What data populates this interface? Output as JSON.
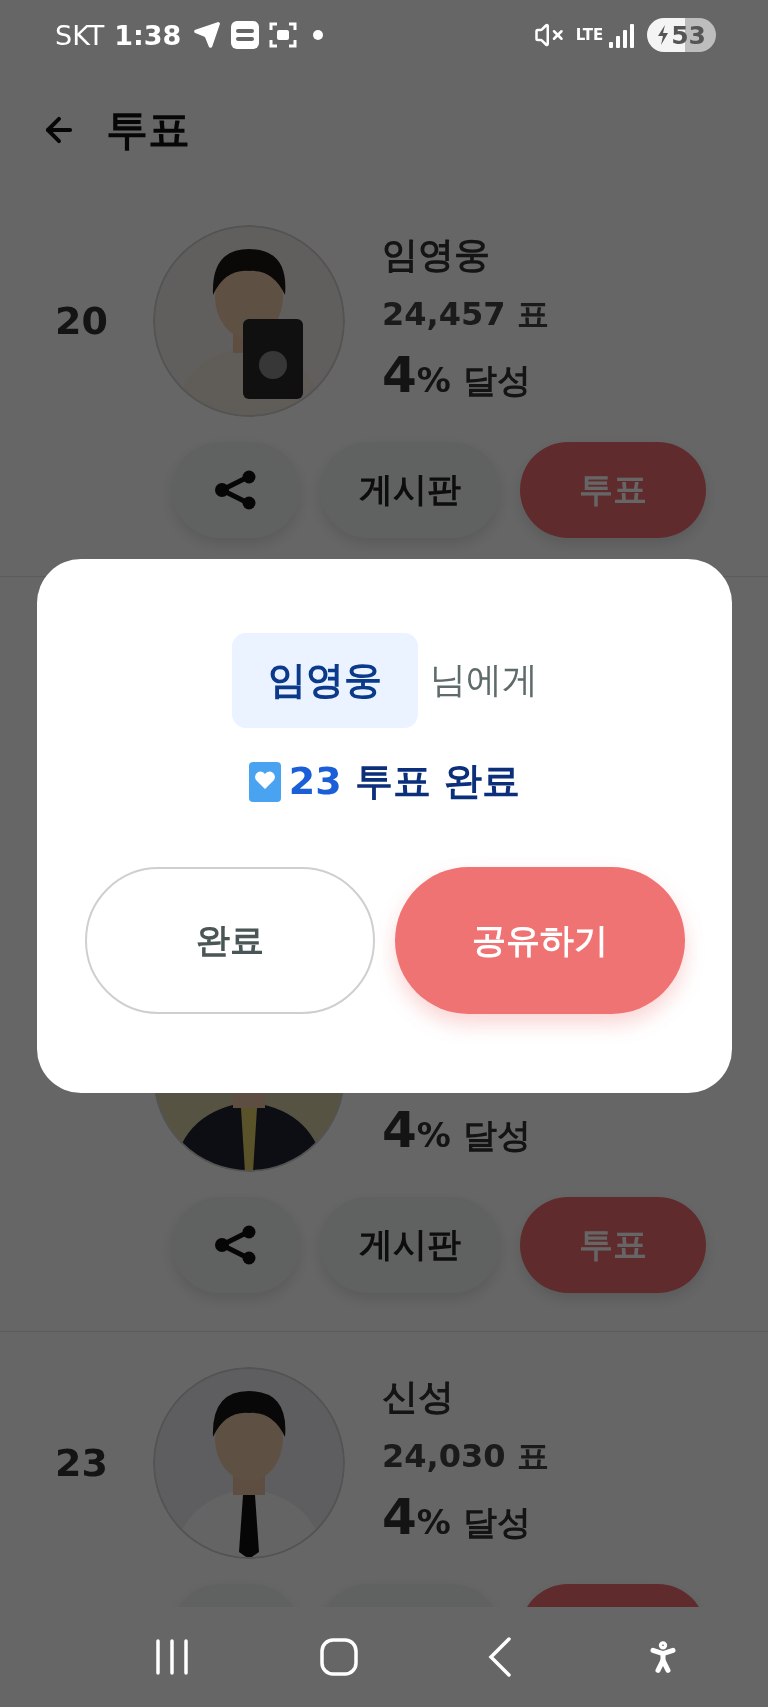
{
  "status_bar": {
    "carrier": "SKT",
    "time": "1:38",
    "network": "LTE",
    "battery": "53"
  },
  "header": {
    "title": "투표"
  },
  "candidates": [
    {
      "rank": "20",
      "name": "임영웅",
      "votes": "24,457 표",
      "percent": "4",
      "percent_label": "% 달성",
      "board_label": "게시판",
      "vote_label": "투표"
    },
    {
      "percent": "4",
      "percent_label": "% 달성",
      "board_label": "게시판",
      "vote_label": "투표"
    },
    {
      "rank": "23",
      "name": "신성",
      "votes": "24,030 표",
      "percent": "4",
      "percent_label": "% 달성"
    }
  ],
  "dialog": {
    "recipient": "임영웅",
    "recipient_suffix": "님에게",
    "vote_count": "23",
    "vote_message": "투표 완료",
    "buttons": [
      {
        "label": "완료",
        "kind": "secondary"
      },
      {
        "label": "공유하기",
        "kind": "primary"
      }
    ]
  }
}
